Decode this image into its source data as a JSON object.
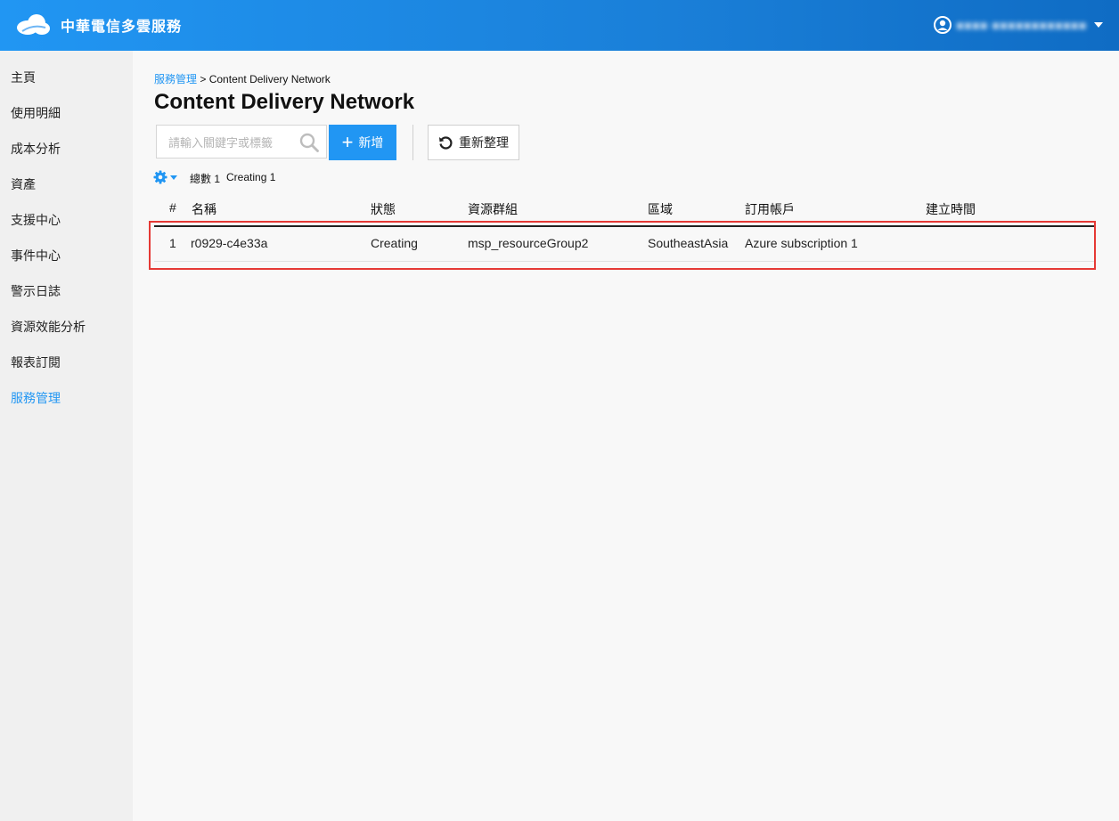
{
  "header": {
    "brand": "中華電信多雲服務",
    "user_name": "■■■■ ■■■■■■■■■■■■"
  },
  "sidebar": {
    "items": [
      {
        "label": "主頁"
      },
      {
        "label": "使用明細"
      },
      {
        "label": "成本分析"
      },
      {
        "label": "資產"
      },
      {
        "label": "支援中心"
      },
      {
        "label": "事件中心"
      },
      {
        "label": "警示日誌"
      },
      {
        "label": "資源效能分析"
      },
      {
        "label": "報表訂閱"
      },
      {
        "label": "服務管理"
      }
    ],
    "active_item": "服務管理"
  },
  "breadcrumb": {
    "parent": "服務管理",
    "separator": ">",
    "current": "Content Delivery Network"
  },
  "page": {
    "title": "Content Delivery Network"
  },
  "toolbar": {
    "search_placeholder": "請輸入關鍵字或標籤",
    "add_label": "新增",
    "refresh_label": "重新整理"
  },
  "summary": {
    "total_label": "總數 1",
    "creating_label": "Creating 1"
  },
  "table": {
    "columns": [
      "#",
      "名稱",
      "狀態",
      "資源群組",
      "區域",
      "訂用帳戶",
      "建立時間"
    ],
    "rows": [
      {
        "index": "1",
        "name": "r0929-c4e33a",
        "status": "Creating",
        "resource_group": "msp_resourceGroup2",
        "region": "SoutheastAsia",
        "subscription": "Azure subscription 1",
        "created": ""
      }
    ]
  },
  "colors": {
    "header_blue": "#2196f3",
    "accent": "#2196f3",
    "highlight": "#e53935"
  },
  "icons": [
    "cloud-logo-icon",
    "user-avatar-icon",
    "caret-down-icon",
    "search-icon",
    "plus-icon",
    "refresh-icon",
    "gear-icon"
  ]
}
